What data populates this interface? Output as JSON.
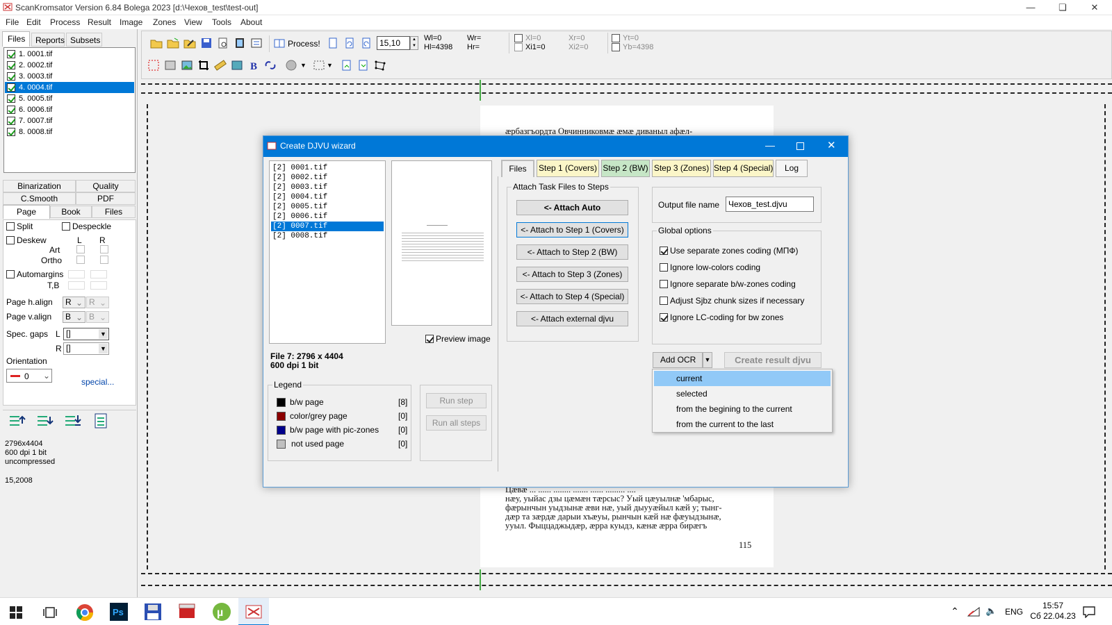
{
  "app": {
    "title": "ScanKromsator    Version 6.84    Bolega 2023    [d:\\Чехов_test\\test-out]"
  },
  "menu": [
    "File",
    "Edit",
    "Process",
    "Result",
    "Image",
    "Zones",
    "View",
    "Tools",
    "About"
  ],
  "left_tabs": [
    "Files",
    "Reports",
    "Subsets"
  ],
  "files": [
    "1. 0001.tif",
    "2. 0002.tif",
    "3. 0003.tif",
    "4. 0004.tif",
    "5. 0005.tif",
    "6. 0006.tif",
    "7. 0007.tif",
    "8. 0008.tif"
  ],
  "selected_file_index": 3,
  "toolbar": {
    "process_label": "Process!",
    "zoom_value": "15,10",
    "wl": "Wl=0",
    "hl": "Hl=4398",
    "wr": "Wr=",
    "hr": "Hr=",
    "xl": "Xl=0",
    "xi1": "Xi1=0",
    "xr": "Xr=0",
    "xi2": "Xi2=0",
    "yt": "Yt=0",
    "yb": "Yb=4398"
  },
  "settings_tabs": {
    "row1": [
      "Binarization",
      "Quality"
    ],
    "row2": [
      "C.Smooth",
      "PDF"
    ],
    "row3": [
      "Page",
      "Book",
      "Files"
    ]
  },
  "page_settings": {
    "split": "Split",
    "despeckle": "Despeckle",
    "deskew": "Deskew",
    "col_l": "L",
    "col_r": "R",
    "art": "Art",
    "ortho": "Ortho",
    "automargins": "Automargins",
    "tb": "T,B",
    "page_halign": "Page h.align",
    "halign_l": "R",
    "halign_r": "R",
    "page_valign": "Page v.align",
    "valign_l": "B",
    "valign_r": "B",
    "spec_gaps": "Spec. gaps",
    "gap_l_label": "L",
    "gap_l_value": "[]",
    "gap_r_label": "R",
    "gap_r_value": "[]",
    "orientation": "Orientation",
    "orientation_value": "0",
    "special_link": "special..."
  },
  "info": {
    "size": "2796x4404",
    "dpi": "600 dpi   1 bit",
    "compression": "uncompressed",
    "value": "15,2008"
  },
  "preview": {
    "line1": "æрбазгъордта   Овчинниковмæ   æмæ   диваныл   афæл-",
    "bottom_lines": [
      "Цæвæ ... ...... ........ ....... ...... ......... ....",
      "нæу, уыйас дзы цæмæн тæрсыс? Уый цæуылнæ 'мбарыс,",
      "фæрынчын уыдзынæ æви нæ, уый дыууæйыл кæй у; тынг-",
      "дæр та зæрдæ дарыи хъæуы, рынчын кæй нæ фæуыдзынæ,",
      "ууыл.  Фыццаджыдæр, æрра куыдз, кæнæ  æрра  бирæгъ"
    ],
    "page_number": "115"
  },
  "dialog": {
    "title": "Create DJVU wizard",
    "files": [
      "[2] 0001.tif",
      "[2] 0002.tif",
      "[2] 0003.tif",
      "[2] 0004.tif",
      "[2] 0005.tif",
      "[2] 0006.tif",
      "[2] 0007.tif",
      "[2] 0008.tif"
    ],
    "selected_index": 6,
    "preview_image_label": "Preview image",
    "file_info_1": "File 7:  2796 x 4404",
    "file_info_2": "600 dpi   1 bit",
    "legend_title": "Legend",
    "legend": [
      {
        "label": "b/w page",
        "count": "[8]",
        "color": "#000000"
      },
      {
        "label": "color/grey page",
        "count": "[0]",
        "color": "#8b0000"
      },
      {
        "label": "b/w page with pic-zones",
        "count": "[0]",
        "color": "#00008b"
      },
      {
        "label": "not used page",
        "count": "[0]",
        "color": "#c0c0c0"
      }
    ],
    "run_step": "Run step",
    "run_all_steps": "Run all steps",
    "tabs": [
      "Files",
      "Step 1 (Covers)",
      "Step 2 (BW)",
      "Step 3 (Zones)",
      "Step 4 (Special)",
      "Log"
    ],
    "active_tab_index": 0,
    "attach_group": "Attach Task Files to Steps",
    "attach_auto": "<- Attach Auto",
    "attach_1": "<- Attach to Step 1 (Covers)",
    "attach_2": "<- Attach to Step 2 (BW)",
    "attach_3": "<- Attach to Step 3 (Zones)",
    "attach_4": "<- Attach to Step 4 (Special)",
    "attach_ext": "<- Attach external djvu",
    "output_label": "Output file name",
    "output_value": "Чехов_test.djvu",
    "global_options": "Global options",
    "options": [
      {
        "label": "Use separate zones coding (МПФ)",
        "checked": true
      },
      {
        "label": "Ignore low-colors coding",
        "checked": false
      },
      {
        "label": "Ignore separate b/w-zones coding",
        "checked": false
      },
      {
        "label": "Adjust Sjbz chunk sizes if necessary",
        "checked": false
      },
      {
        "label": "Ignore LC-coding for bw zones",
        "checked": true
      }
    ],
    "add_ocr": "Add OCR",
    "create_result": "Create result djvu",
    "ocr_menu": [
      "current",
      "selected",
      "from the begining to the current",
      "from the current to the last"
    ],
    "ocr_menu_highlight": 0
  },
  "taskbar": {
    "lang": "ENG",
    "time": "15:57",
    "date": "Сб 22.04.23"
  },
  "colors": {
    "accent": "#0078d7",
    "step_tab_green": "#c6e6c6",
    "step_tab_yellow": "#fbf6c8"
  }
}
